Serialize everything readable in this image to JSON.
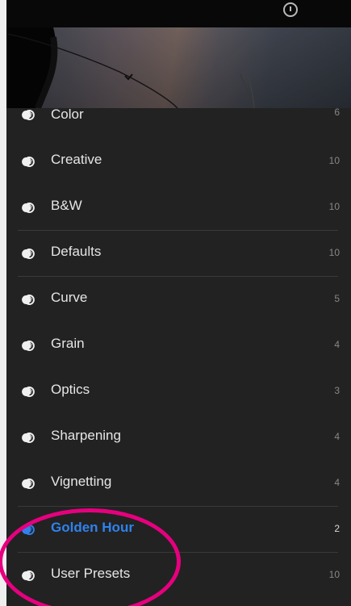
{
  "app": {
    "help_icon_name": "help-icon",
    "selection_color": "#2f82ec",
    "annotation_color": "#e6007e"
  },
  "presets": {
    "items": [
      {
        "label": "Color",
        "count": "6",
        "icon": "preset-icon",
        "selected": false
      },
      {
        "label": "Creative",
        "count": "10",
        "icon": "preset-icon",
        "selected": false
      },
      {
        "label": "B&W",
        "count": "10",
        "icon": "preset-icon",
        "selected": false
      },
      {
        "label": "Defaults",
        "count": "10",
        "icon": "preset-icon",
        "selected": false
      },
      {
        "label": "Curve",
        "count": "5",
        "icon": "preset-icon",
        "selected": false
      },
      {
        "label": "Grain",
        "count": "4",
        "icon": "preset-icon",
        "selected": false
      },
      {
        "label": "Optics",
        "count": "3",
        "icon": "preset-icon",
        "selected": false
      },
      {
        "label": "Sharpening",
        "count": "4",
        "icon": "preset-icon",
        "selected": false
      },
      {
        "label": "Vignetting",
        "count": "4",
        "icon": "preset-icon",
        "selected": false
      },
      {
        "label": "Golden Hour",
        "count": "2",
        "icon": "preset-icon",
        "selected": true
      },
      {
        "label": "User Presets",
        "count": "10",
        "icon": "preset-icon",
        "selected": false
      }
    ]
  }
}
